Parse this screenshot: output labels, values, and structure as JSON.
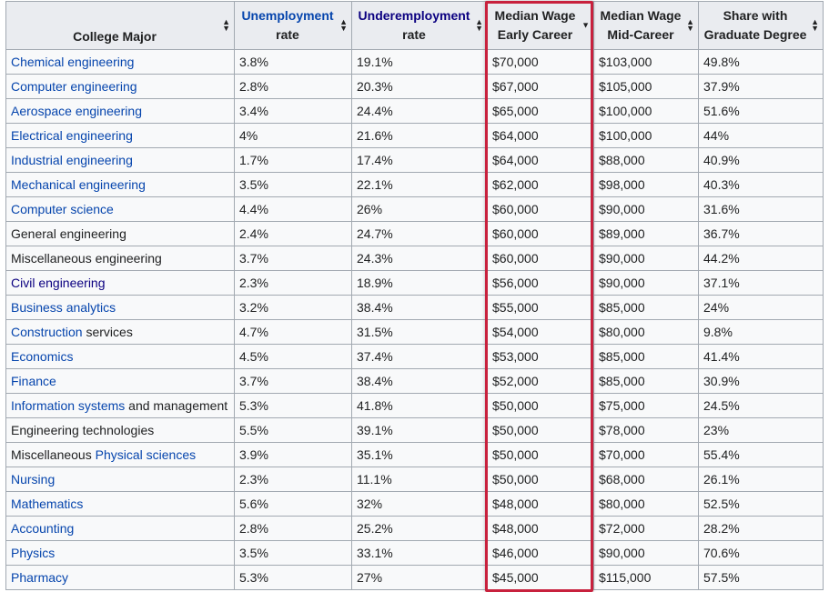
{
  "headers": [
    {
      "label": "College Major",
      "line1": "",
      "line2": "College Major",
      "link": false
    },
    {
      "label": "Unemployment rate",
      "line1": "Unemployment",
      "line2": "rate",
      "link": true,
      "visited": false
    },
    {
      "label": "Underemployment rate",
      "line1": "Underemployment",
      "line2": "rate",
      "link": true,
      "visited": true
    },
    {
      "label": "Median Wage Early Career",
      "line1": "Median Wage",
      "line2": "Early Career",
      "link": false
    },
    {
      "label": "Median Wage Mid-Career",
      "line1": "Median Wage",
      "line2": "Mid-Career",
      "link": false
    },
    {
      "label": "Share with Graduate Degree",
      "line1": "Share with",
      "line2": "Graduate Degree",
      "link": false
    }
  ],
  "rows": [
    {
      "major": [
        {
          "t": "Chemical engineering",
          "link": true
        }
      ],
      "unemp": "3.8%",
      "under": "19.1%",
      "early": "$70,000",
      "mid": "$103,000",
      "grad": "49.8%"
    },
    {
      "major": [
        {
          "t": "Computer engineering",
          "link": true
        }
      ],
      "unemp": "2.8%",
      "under": "20.3%",
      "early": "$67,000",
      "mid": "$105,000",
      "grad": "37.9%"
    },
    {
      "major": [
        {
          "t": "Aerospace engineering",
          "link": true
        }
      ],
      "unemp": "3.4%",
      "under": "24.4%",
      "early": "$65,000",
      "mid": "$100,000",
      "grad": "51.6%"
    },
    {
      "major": [
        {
          "t": "Electrical engineering",
          "link": true
        }
      ],
      "unemp": "4%",
      "under": "21.6%",
      "early": "$64,000",
      "mid": "$100,000",
      "grad": "44%"
    },
    {
      "major": [
        {
          "t": "Industrial engineering",
          "link": true
        }
      ],
      "unemp": "1.7%",
      "under": "17.4%",
      "early": "$64,000",
      "mid": "$88,000",
      "grad": "40.9%"
    },
    {
      "major": [
        {
          "t": "Mechanical engineering",
          "link": true
        }
      ],
      "unemp": "3.5%",
      "under": "22.1%",
      "early": "$62,000",
      "mid": "$98,000",
      "grad": "40.3%"
    },
    {
      "major": [
        {
          "t": "Computer science",
          "link": true
        }
      ],
      "unemp": "4.4%",
      "under": "26%",
      "early": "$60,000",
      "mid": "$90,000",
      "grad": "31.6%"
    },
    {
      "major": [
        {
          "t": "General engineering",
          "link": false
        }
      ],
      "unemp": "2.4%",
      "under": "24.7%",
      "early": "$60,000",
      "mid": "$89,000",
      "grad": "36.7%"
    },
    {
      "major": [
        {
          "t": "Miscellaneous engineering",
          "link": false
        }
      ],
      "unemp": "3.7%",
      "under": "24.3%",
      "early": "$60,000",
      "mid": "$90,000",
      "grad": "44.2%"
    },
    {
      "major": [
        {
          "t": "Civil engineering",
          "link": true,
          "visited": true
        }
      ],
      "unemp": "2.3%",
      "under": "18.9%",
      "early": "$56,000",
      "mid": "$90,000",
      "grad": "37.1%"
    },
    {
      "major": [
        {
          "t": "Business analytics",
          "link": true
        }
      ],
      "unemp": "3.2%",
      "under": "38.4%",
      "early": "$55,000",
      "mid": "$85,000",
      "grad": "24%"
    },
    {
      "major": [
        {
          "t": "Construction",
          "link": true
        },
        {
          "t": " services",
          "link": false
        }
      ],
      "unemp": "4.7%",
      "under": "31.5%",
      "early": "$54,000",
      "mid": "$80,000",
      "grad": "9.8%"
    },
    {
      "major": [
        {
          "t": "Economics",
          "link": true
        }
      ],
      "unemp": "4.5%",
      "under": "37.4%",
      "early": "$53,000",
      "mid": "$85,000",
      "grad": "41.4%"
    },
    {
      "major": [
        {
          "t": "Finance",
          "link": true
        }
      ],
      "unemp": "3.7%",
      "under": "38.4%",
      "early": "$52,000",
      "mid": "$85,000",
      "grad": "30.9%"
    },
    {
      "major": [
        {
          "t": "Information systems",
          "link": true
        },
        {
          "t": " and management",
          "link": false
        }
      ],
      "unemp": "5.3%",
      "under": "41.8%",
      "early": "$50,000",
      "mid": "$75,000",
      "grad": "24.5%"
    },
    {
      "major": [
        {
          "t": "Engineering technologies",
          "link": false
        }
      ],
      "unemp": "5.5%",
      "under": "39.1%",
      "early": "$50,000",
      "mid": "$78,000",
      "grad": "23%"
    },
    {
      "major": [
        {
          "t": "Miscellaneous ",
          "link": false
        },
        {
          "t": "Physical sciences",
          "link": true
        }
      ],
      "unemp": "3.9%",
      "under": "35.1%",
      "early": "$50,000",
      "mid": "$70,000",
      "grad": "55.4%"
    },
    {
      "major": [
        {
          "t": "Nursing",
          "link": true
        }
      ],
      "unemp": "2.3%",
      "under": "11.1%",
      "early": "$50,000",
      "mid": "$68,000",
      "grad": "26.1%"
    },
    {
      "major": [
        {
          "t": "Mathematics",
          "link": true
        }
      ],
      "unemp": "5.6%",
      "under": "32%",
      "early": "$48,000",
      "mid": "$80,000",
      "grad": "52.5%"
    },
    {
      "major": [
        {
          "t": "Accounting",
          "link": true
        }
      ],
      "unemp": "2.8%",
      "under": "25.2%",
      "early": "$48,000",
      "mid": "$72,000",
      "grad": "28.2%"
    },
    {
      "major": [
        {
          "t": "Physics",
          "link": true
        }
      ],
      "unemp": "3.5%",
      "under": "33.1%",
      "early": "$46,000",
      "mid": "$90,000",
      "grad": "70.6%"
    },
    {
      "major": [
        {
          "t": "Pharmacy",
          "link": true
        }
      ],
      "unemp": "5.3%",
      "under": "27%",
      "early": "$45,000",
      "mid": "$115,000",
      "grad": "57.5%"
    }
  ],
  "colors": {
    "link": "#0645ad",
    "visited": "#0b0080",
    "highlight": "#c8213d",
    "header_bg": "#eaecf0",
    "cell_bg": "#f8f9fa",
    "border": "#a2a9b1"
  },
  "icons": {
    "sort": "sort-both-icon",
    "sorted": "sort-desc-icon"
  }
}
